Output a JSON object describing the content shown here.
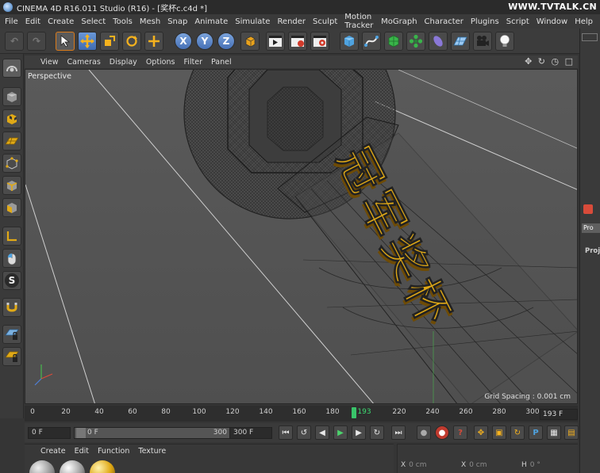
{
  "titlebar": {
    "title": "CINEMA 4D R16.011 Studio (R16) - [奖杯c.c4d *]",
    "watermark": "WWW.TVTALK.CN"
  },
  "menu": [
    "File",
    "Edit",
    "Create",
    "Select",
    "Tools",
    "Mesh",
    "Snap",
    "Animate",
    "Simulate",
    "Render",
    "Sculpt",
    "Motion Tracker",
    "MoGraph",
    "Character",
    "Plugins",
    "Script",
    "Window",
    "Help"
  ],
  "toolbar": {
    "x_label": "X",
    "y_label": "Y",
    "z_label": "Z",
    "icons": [
      "undo-icon",
      "redo-icon",
      "live-selection-icon",
      "move-icon",
      "scale-icon",
      "rotate-icon",
      "add-icon",
      "x-axis-lock-icon",
      "y-axis-lock-icon",
      "z-axis-lock-icon",
      "world-coordinates-icon",
      "render-view-icon",
      "render-picture-viewer-icon",
      "render-settings-icon",
      "cube-icon",
      "pen-spline-icon",
      "subdivision-surface-icon",
      "array-icon",
      "deformer-icon",
      "floor-icon",
      "camera-icon",
      "light-icon"
    ]
  },
  "left_tools": {
    "icons": [
      "layout-icon",
      "model-mode-icon",
      "texture-mode-icon",
      "workplane-icon",
      "points-mode-icon",
      "edges-mode-icon",
      "polygons-mode-icon",
      "axis-mode-icon",
      "tweak-mode-icon",
      "solo-icon",
      "snap-icon",
      "grid-lock-icon",
      "workplane-lock-icon"
    ]
  },
  "viewport_menu": {
    "items": [
      "View",
      "Cameras",
      "Display",
      "Options",
      "Filter",
      "Panel"
    ],
    "nav_icons": "✥ ↻ ◷ □"
  },
  "viewport": {
    "label": "Perspective",
    "grid_spacing": "Grid Spacing : 0.001 cm",
    "model_text": "冠军奖杯",
    "gold_color": "#e0a916",
    "wire_color": "#222222"
  },
  "timeline": {
    "ticks": [
      "0",
      "20",
      "40",
      "60",
      "80",
      "100",
      "120",
      "140",
      "160",
      "180",
      "220",
      "240",
      "260",
      "280",
      "300"
    ],
    "playhead_label": "193",
    "current_frame": "193 F"
  },
  "transport": {
    "start_field": "0 F",
    "range_start": "0 F",
    "range_end": "300 F",
    "end_field": "300 F"
  },
  "materials": {
    "menu": [
      "Create",
      "Edit",
      "Function",
      "Texture"
    ]
  },
  "coordinates": {
    "x_label": "X",
    "x_value": "0 cm",
    "x2_label": "X",
    "x2_value": "0 cm",
    "h_label": "H",
    "h_value": "0 °"
  },
  "right_panel": {
    "tab": "Pro",
    "heading": "Proj"
  }
}
